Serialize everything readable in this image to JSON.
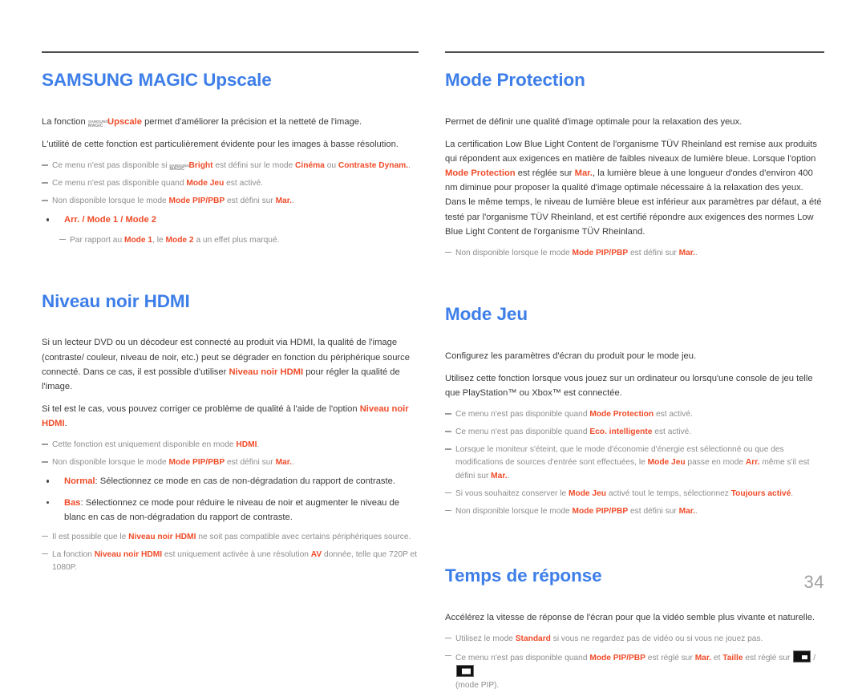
{
  "document": {
    "page_number": "34",
    "colors": {
      "heading_blue": "#3d7ee8",
      "highlight_orange": "#f04c2a",
      "note_grey": "#8d8d8d",
      "body_grey": "#3a3a3a",
      "rule_grey": "#4d4d4d"
    }
  },
  "left_column": {
    "sections": [
      {
        "title": "SAMSUNG MAGIC Upscale",
        "logo_line1": "SAMSUNG",
        "logo_line2": "MAGIC",
        "paragraphs": {
          "p1_prefix": "La fonction ",
          "p1_highlight": "Upscale",
          "p1_suffix": " permet d'améliorer la précision et la netteté de l'image.",
          "p2": "L'utilité de cette fonction est particulièrement évidente pour les images à basse résolution."
        },
        "notes": {
          "n1_a": "Ce menu n'est pas disponible si ",
          "n1_b": "Bright",
          "n1_c": " est défini sur le mode ",
          "n1_d": "Cinéma",
          "n1_e": " ou ",
          "n1_f": "Contraste Dynam.",
          "n1_g": ".",
          "n2_a": "Ce menu n'est pas disponible quand ",
          "n2_b": "Mode Jeu",
          "n2_c": " est activé.",
          "n3_a": "Non disponible lorsque le mode ",
          "n3_b": "Mode PIP/PBP",
          "n3_c": " est défini sur ",
          "n3_d": "Mar.",
          "n3_e": ".",
          "n4_a": "Par rapport au ",
          "n4_b": "Mode 1",
          "n4_c": ", le ",
          "n4_d": "Mode 2",
          "n4_e": " a un effet plus marqué."
        },
        "bullets": {
          "b1_a": "Arr.",
          "b1_sep1": " / ",
          "b1_b": "Mode 1",
          "b1_sep2": " / ",
          "b1_c": "Mode 2"
        }
      },
      {
        "title": "Niveau noir HDMI",
        "paragraphs": {
          "p1_a": "Si un lecteur DVD ou un décodeur est connecté au produit via HDMI, la qualité de l'image (contraste/ couleur, niveau de noir, etc.) peut se dégrader en fonction du périphérique source connecté. Dans ce cas, il est possible d'utiliser ",
          "p1_b": "Niveau noir HDMI",
          "p1_c": " pour régler la qualité de l'image.",
          "p2_a": "Si tel est le cas, vous pouvez corriger ce problème de qualité à l'aide de l'option ",
          "p2_b": "Niveau noir HDMI",
          "p2_c": "."
        },
        "notes": {
          "n1_a": "Cette fonction est uniquement disponible en mode ",
          "n1_b": "HDMI",
          "n1_c": ".",
          "n2_a": "Non disponible lorsque le mode ",
          "n2_b": "Mode PIP/PBP",
          "n2_c": " est défini sur ",
          "n2_d": "Mar.",
          "n2_e": ".",
          "n3_a": "Il est possible que le ",
          "n3_b": "Niveau noir HDMI",
          "n3_c": " ne soit pas compatible avec certains périphériques source.",
          "n4_a": "La fonction ",
          "n4_b": "Niveau noir HDMI",
          "n4_c": " est uniquement activée à une résolution ",
          "n4_d": "AV",
          "n4_e": " donnée, telle que 720P et 1080P."
        },
        "bullets": {
          "b1_label": "Normal",
          "b1_text": ": Sélectionnez ce mode en cas de non-dégradation du rapport de contraste.",
          "b2_label": "Bas",
          "b2_text": ": Sélectionnez ce mode pour réduire le niveau de noir et augmenter le niveau de blanc en cas de non-dégradation du rapport de contraste."
        }
      }
    ]
  },
  "right_column": {
    "sections": [
      {
        "title": "Mode Protection",
        "paragraphs": {
          "p1": "Permet de définir une qualité d'image optimale pour la relaxation des yeux.",
          "p2_a": "La certification Low Blue Light Content de l'organisme TÜV Rheinland est remise aux produits qui répondent aux exigences en matière de faibles niveaux de lumière bleue. Lorsque l'option ",
          "p2_b": "Mode Protection",
          "p2_c": " est réglée sur ",
          "p2_d": "Mar.",
          "p2_e": ", la lumière bleue à une longueur d'ondes d'environ 400 nm diminue pour proposer la qualité d'image optimale nécessaire à la relaxation des yeux. Dans le même temps, le niveau de lumière bleue est inférieur aux paramètres par défaut, a été testé par l'organisme TÜV Rheinland, et est certifié répondre aux exigences des normes Low Blue Light Content de l'organisme TÜV Rheinland."
        },
        "notes": {
          "n1_a": "Non disponible lorsque le mode ",
          "n1_b": "Mode PIP/PBP",
          "n1_c": " est défini sur ",
          "n1_d": "Mar.",
          "n1_e": "."
        }
      },
      {
        "title": "Mode Jeu",
        "paragraphs": {
          "p1": "Configurez les paramètres d'écran du produit pour le mode jeu.",
          "p2": "Utilisez cette fonction lorsque vous jouez sur un ordinateur ou lorsqu'une console de jeu telle que PlayStation™ ou Xbox™ est connectée."
        },
        "notes": {
          "n1_a": "Ce menu n'est pas disponible quand ",
          "n1_b": "Mode Protection",
          "n1_c": " est activé.",
          "n2_a": "Ce menu n'est pas disponible quand ",
          "n2_b": "Eco. intelligente",
          "n2_c": " est activé.",
          "n3_a": "Lorsque le moniteur s'éteint, que le mode d'économie d'énergie est sélectionné ou que des modifications de sources d'entrée sont effectuées, le ",
          "n3_b": "Mode Jeu",
          "n3_c": " passe en mode ",
          "n3_d": "Arr.",
          "n3_e": " même s'il est défini sur ",
          "n3_f": "Mar.",
          "n3_g": ".",
          "n4_a": "Si vous souhaitez conserver le ",
          "n4_b": "Mode Jeu",
          "n4_c": " activé tout le temps, sélectionnez ",
          "n4_d": "Toujours activé",
          "n4_e": ".",
          "n5_a": "Non disponible lorsque le mode ",
          "n5_b": "Mode PIP/PBP",
          "n5_c": " est défini sur ",
          "n5_d": "Mar.",
          "n5_e": "."
        }
      },
      {
        "title": "Temps de réponse",
        "paragraphs": {
          "p1": "Accélérez la vitesse de réponse de l'écran pour que la vidéo semble plus vivante et naturelle."
        },
        "notes": {
          "n1_a": "Utilisez le mode ",
          "n1_b": "Standard",
          "n1_c": " si vous ne regardez pas de vidéo ou si vous ne jouez pas.",
          "n2_a": "Ce menu n'est pas disponible quand ",
          "n2_b": "Mode PIP/PBP",
          "n2_c": " est réglé sur ",
          "n2_d": "Mar.",
          "n2_e": " et ",
          "n2_f": "Taille",
          "n2_g": " est réglé sur ",
          "n2_icon_sep": "/",
          "n2_h": "(mode PIP)."
        },
        "icons": {
          "pip_small": "pip-size-small-icon",
          "pip_large": "pip-size-large-icon"
        }
      }
    ]
  }
}
